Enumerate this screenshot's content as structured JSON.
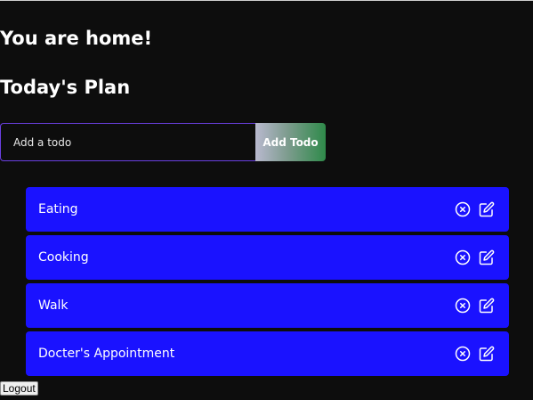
{
  "page": {
    "home_title": "You are home!",
    "plan_title": "Today's Plan"
  },
  "form": {
    "input_value": "",
    "input_placeholder": "Add a todo",
    "add_label": "Add Todo"
  },
  "todos": [
    {
      "text": "Eating",
      "delete_icon": "circle-x-icon",
      "edit_icon": "edit-icon"
    },
    {
      "text": "Cooking",
      "delete_icon": "circle-x-icon",
      "edit_icon": "edit-icon"
    },
    {
      "text": "Walk",
      "delete_icon": "circle-x-icon",
      "edit_icon": "edit-icon"
    },
    {
      "text": "Docter's Appointment",
      "delete_icon": "circle-x-icon",
      "edit_icon": "edit-icon"
    }
  ],
  "logout_label": "Logout",
  "colors": {
    "background": "#0d0d0d",
    "todo_item": "#1a12ff",
    "input_border": "#6a3fe0",
    "button_gradient_start": "#b9b9cf",
    "button_gradient_end": "#2f8a4a"
  }
}
